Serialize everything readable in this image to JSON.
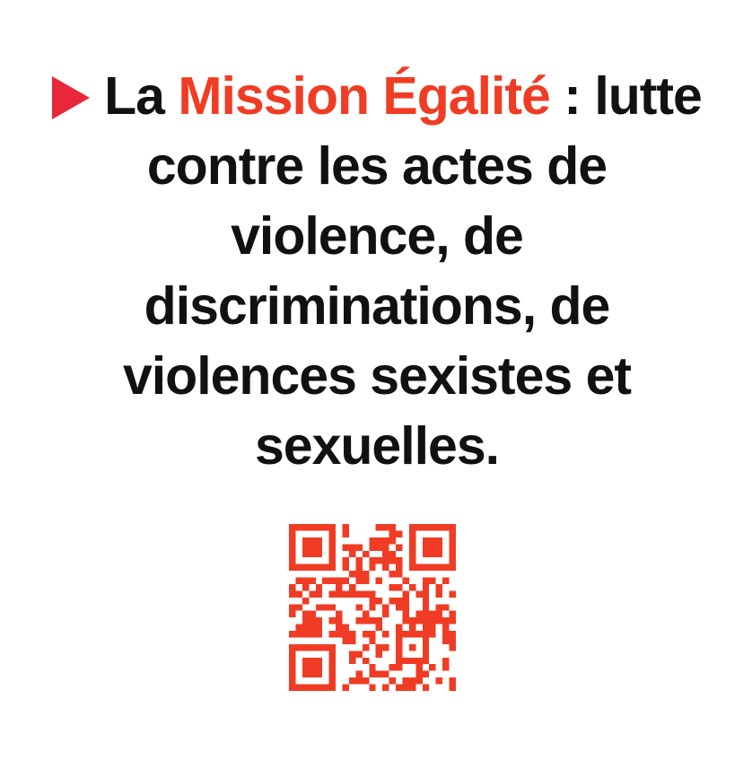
{
  "statement": {
    "prefix": "La",
    "highlight": "Mission Égalité",
    "line1_rest": ": lutte",
    "line2": "contre les actes de",
    "line3": "violence, de",
    "line4": "discriminations, de",
    "line5": "violences sexistes et",
    "line6": "sexuelles."
  },
  "icons": {
    "bullet": "triangle-play-icon",
    "code": "qr-code"
  },
  "colors": {
    "text": "#111111",
    "highlight": "#f03c24",
    "bullet": "#e8283a",
    "qr": "#f03c24",
    "background": "#ffffff"
  }
}
